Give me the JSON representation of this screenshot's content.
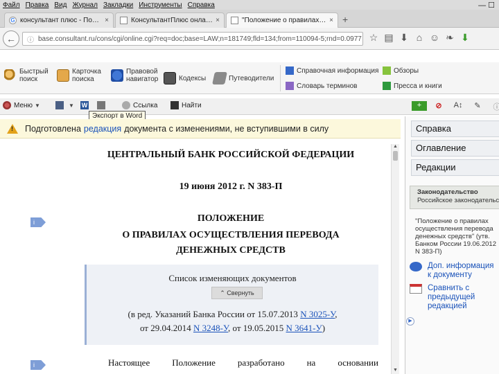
{
  "menubar": {
    "items": [
      "Файл",
      "Правка",
      "Вид",
      "Журнал",
      "Закладки",
      "Инструменты",
      "Справка"
    ],
    "window_controls": "— ☐"
  },
  "tabs": [
    {
      "title": "консультант плюс - Поис...",
      "close": "×"
    },
    {
      "title": "КонсультантПлюс онлайн ...",
      "close": "×"
    },
    {
      "title": "\"Положение о правилах ...",
      "close": "×"
    }
  ],
  "newtab": "+",
  "address": {
    "back": "←",
    "url": "base.consultant.ru/cons/cgi/online.cgi?req=doc;base=LAW;n=181749;fld=134;from=110094-5;rnd=0.0977",
    "lock": "ⓘ",
    "icons": [
      "☆",
      "▤",
      "⬇",
      "⌂",
      "☺",
      "❧",
      "⬇"
    ]
  },
  "toolbar1": {
    "quick_search": "Быстрый поиск",
    "card_search": "Карточка поиска",
    "legal_navigator": "Правовой навигатор",
    "codexes": "Кодексы",
    "guides": "Путеводители",
    "reference_info": "Справочная информация",
    "reviews": "Обзоры",
    "dictionary": "Словарь терминов",
    "press_books": "Пресса и книги"
  },
  "toolbar2": {
    "menu": "Меню",
    "link": "Ссылка",
    "find": "Найти",
    "word": "W"
  },
  "tooltip": "Экспорт в Word",
  "notice": {
    "before": "Подготовлена",
    "link": "редакция",
    "after": "документа с изменениями, не вступившими в силу"
  },
  "document": {
    "org": "ЦЕНТРАЛЬНЫЙ БАНК РОССИЙСКОЙ ФЕДЕРАЦИИ",
    "date_line": "19 июня 2012 г. N 383-П",
    "heading1": "ПОЛОЖЕНИЕ",
    "heading2": "О ПРАВИЛАХ ОСУЩЕСТВЛЕНИЯ ПЕРЕВОДА",
    "heading3": "ДЕНЕЖНЫХ СРЕДСТВ",
    "info_badge": "i",
    "changes_title": "Список изменяющих документов",
    "collapse": "⌃ Свернуть",
    "line1_pre": "(в ред. Указаний Банка России от 15.07.2013",
    "line1_link": "N 3025-У",
    "line1_post": ",",
    "line2_pre": "от 29.04.2014",
    "line2_link1": "N 3248-У",
    "line2_mid": ", от 19.05.2015",
    "line2_link2": "N 3641-У",
    "line2_post": ")",
    "body_words": [
      "Настоящее",
      "Положение",
      "разработано",
      "на",
      "основании"
    ]
  },
  "rightpanel": {
    "tabs": [
      "Справка",
      "Оглавление",
      "Редакции"
    ],
    "legislation_title": "Законодательство",
    "legislation_sub": "Российское законодательство",
    "doc_name": "\"Положение о правилах осуществления перевода денежных средств\" (утв. Банком России 19.06.2012 N 383-П)",
    "extra_info": "Доп. информация к документу",
    "compare": "Сравнить с предыдущей редакцией"
  }
}
